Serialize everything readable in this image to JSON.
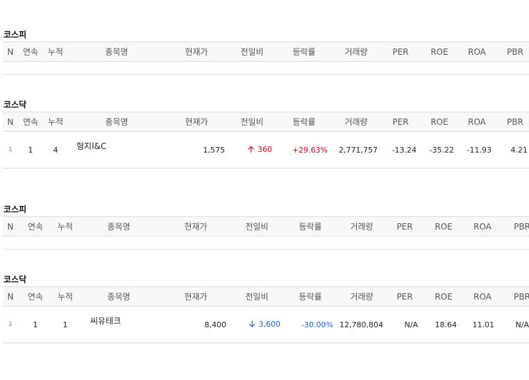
{
  "headers": [
    "N",
    "연속",
    "누적",
    "종목명",
    "현재가",
    "전일비",
    "등락률",
    "거래량",
    "PER",
    "ROE",
    "ROA",
    "PBR"
  ],
  "sections": [
    {
      "title": "코스피",
      "rows": []
    },
    {
      "title": "코스닥",
      "rows": [
        {
          "n": "1",
          "streak": "1",
          "total": "4",
          "name": "형지I&C",
          "price": "1,575",
          "dir": "up",
          "change": "360",
          "rate": "+29.63%",
          "volume": "2,771,757",
          "per": "-13.24",
          "roe": "-35.22",
          "roa": "-11.93",
          "pbr": "4.21"
        }
      ]
    },
    {
      "title": "코스피",
      "rows": []
    },
    {
      "title": "코스닥",
      "rows": [
        {
          "n": "1",
          "streak": "1",
          "total": "1",
          "name": "씨유테크",
          "price": "8,400",
          "dir": "down",
          "change": "3,600",
          "rate": "-30.00%",
          "volume": "12,780,804",
          "per": "N/A",
          "roe": "18.64",
          "roa": "11.01",
          "pbr": "N/A"
        }
      ]
    }
  ],
  "icons": {
    "up": "arrow-up-icon",
    "down": "arrow-down-icon"
  },
  "colors": {
    "up": "#d0021b",
    "down": "#1a5fc9"
  }
}
